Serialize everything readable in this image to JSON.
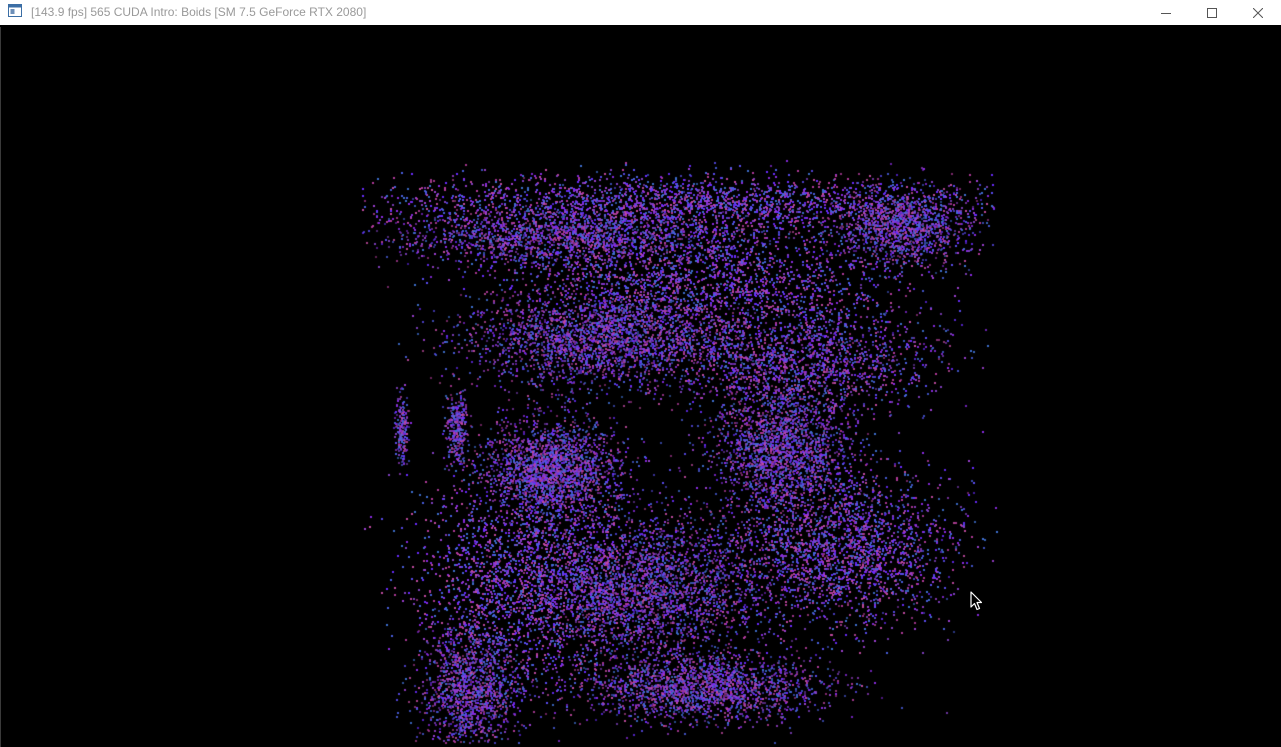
{
  "window": {
    "title": "[143.9 fps] 565 CUDA Intro: Boids [SM 7.5 GeForce RTX 2080]",
    "app_icon": "application-window-icon",
    "controls": {
      "minimize_icon": "minimize-icon",
      "maximize_icon": "maximize-icon",
      "close_icon": "close-icon"
    }
  },
  "simulation": {
    "background": "#000000",
    "particle_colors": [
      "#6a2cff",
      "#8a2be2",
      "#9b3fd0",
      "#b03a9a",
      "#4a5fe0",
      "#7f3fbf",
      "#c04aa0",
      "#5a4cf0",
      "#3f6fd0"
    ],
    "cursor_icon": "mouse-pointer-icon"
  }
}
